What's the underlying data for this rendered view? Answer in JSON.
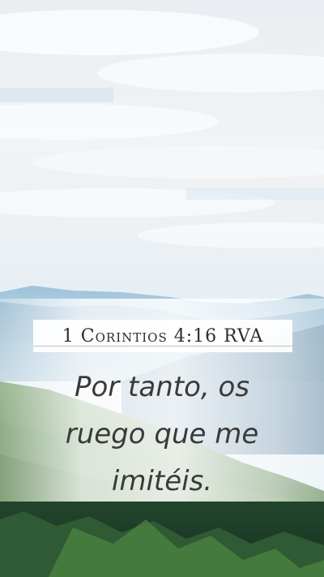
{
  "reference": "1 Corintios 4:16 RVA",
  "verse": {
    "line1": "Por tanto, os",
    "line2": "ruego que me",
    "line3": "imitéis."
  }
}
